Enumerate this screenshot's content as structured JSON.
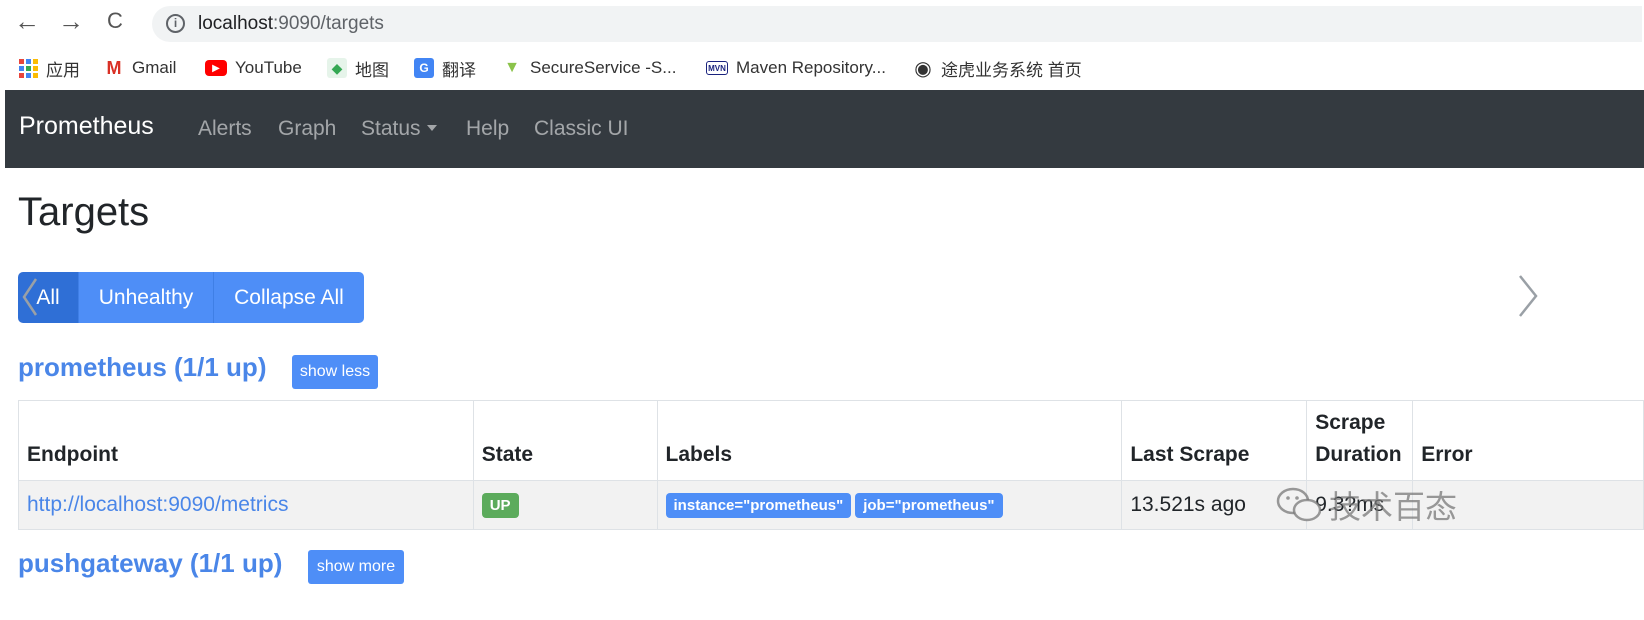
{
  "browser": {
    "url_host": "localhost",
    "url_path": ":9090/targets",
    "back_glyph": "←",
    "forward_glyph": "→",
    "reload_glyph": "C",
    "info_glyph": "i"
  },
  "bookmarks": [
    {
      "label": "应用",
      "icon": "apps-grid-icon"
    },
    {
      "label": "Gmail",
      "icon": "gmail-icon",
      "icon_text": "M",
      "color": "#d93025"
    },
    {
      "label": "YouTube",
      "icon": "youtube-icon",
      "icon_text": "▶",
      "color": "#ff0000"
    },
    {
      "label": "地图",
      "icon": "maps-icon",
      "icon_text": "◆",
      "color": "#34a853"
    },
    {
      "label": "翻译",
      "icon": "translate-icon",
      "icon_text": "G",
      "color": "#4285f4"
    },
    {
      "label": "SecureService -S...",
      "icon": "secureservice-icon",
      "icon_text": "▼",
      "color": "#8bc34a"
    },
    {
      "label": "Maven Repository...",
      "icon": "maven-icon",
      "icon_text": "MVN",
      "color": "#1a237e"
    },
    {
      "label": "途虎业务系统 首页",
      "icon": "globe-icon",
      "icon_text": "◉",
      "color": "#333333"
    }
  ],
  "navbar": {
    "brand": "Prometheus",
    "links": [
      "Alerts",
      "Graph",
      "Status",
      "Help",
      "Classic UI"
    ]
  },
  "page": {
    "title": "Targets",
    "filter_buttons": [
      "All",
      "Unhealthy",
      "Collapse All"
    ],
    "active_filter": "All"
  },
  "jobs": [
    {
      "name": "prometheus (1/1 up)",
      "toggle_label": "show less",
      "columns": [
        "Endpoint",
        "State",
        "Labels",
        "Last Scrape",
        "Scrape Duration",
        "Error"
      ],
      "rows": [
        {
          "endpoint": "http://localhost:9090/metrics",
          "state": "UP",
          "labels": [
            "instance=\"prometheus\"",
            "job=\"prometheus\""
          ],
          "last_scrape": "13.521s ago",
          "scrape_duration": "9.3?ms",
          "error": ""
        }
      ]
    },
    {
      "name": "pushgateway (1/1 up)",
      "toggle_label": "show more"
    }
  ],
  "watermark": {
    "text": "技术百态",
    "icon": "wechat-icon"
  },
  "colors": {
    "navbar_bg": "#343a40",
    "primary": "#4e8ef7",
    "link": "#4a86e8",
    "success": "#5cab5c"
  }
}
